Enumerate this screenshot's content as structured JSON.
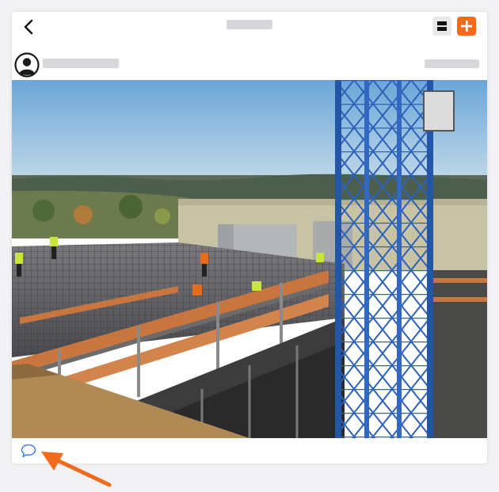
{
  "header": {
    "back_icon": "chevron-left-icon",
    "layout_icon": "list-layout-icon",
    "add_icon": "plus-icon"
  },
  "post": {
    "avatar_icon": "user-avatar-icon",
    "comment_icon": "speech-bubble-icon"
  },
  "annotation": {
    "arrow_icon": "pointer-arrow-icon"
  },
  "colors": {
    "accent": "#f26b1d",
    "comment_icon": "#3b82f6",
    "placeholder": "#d7d7db"
  }
}
